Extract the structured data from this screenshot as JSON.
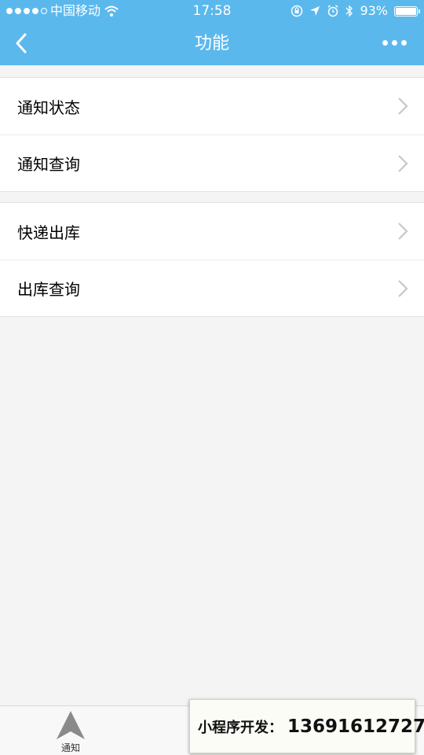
{
  "status_bar": {
    "carrier": "中国移动",
    "time": "17:58",
    "battery_percent": "93%",
    "battery_level": 0.93
  },
  "navbar": {
    "title": "功能",
    "back_icon": "chevron-left-icon",
    "more_icon": "more-dots-icon"
  },
  "menu": {
    "group1": [
      {
        "label": "通知状态"
      },
      {
        "label": "通知查询"
      }
    ],
    "group2": [
      {
        "label": "快递出库"
      },
      {
        "label": "出库查询"
      }
    ]
  },
  "tabbar": {
    "tabs": [
      {
        "label": "通知",
        "icon": "send-arrow-icon"
      }
    ]
  },
  "promo": {
    "label": "小程序开发：",
    "phone": "13691612727"
  },
  "colors": {
    "header": "#5bb8ec",
    "background": "#f4f4f4"
  }
}
